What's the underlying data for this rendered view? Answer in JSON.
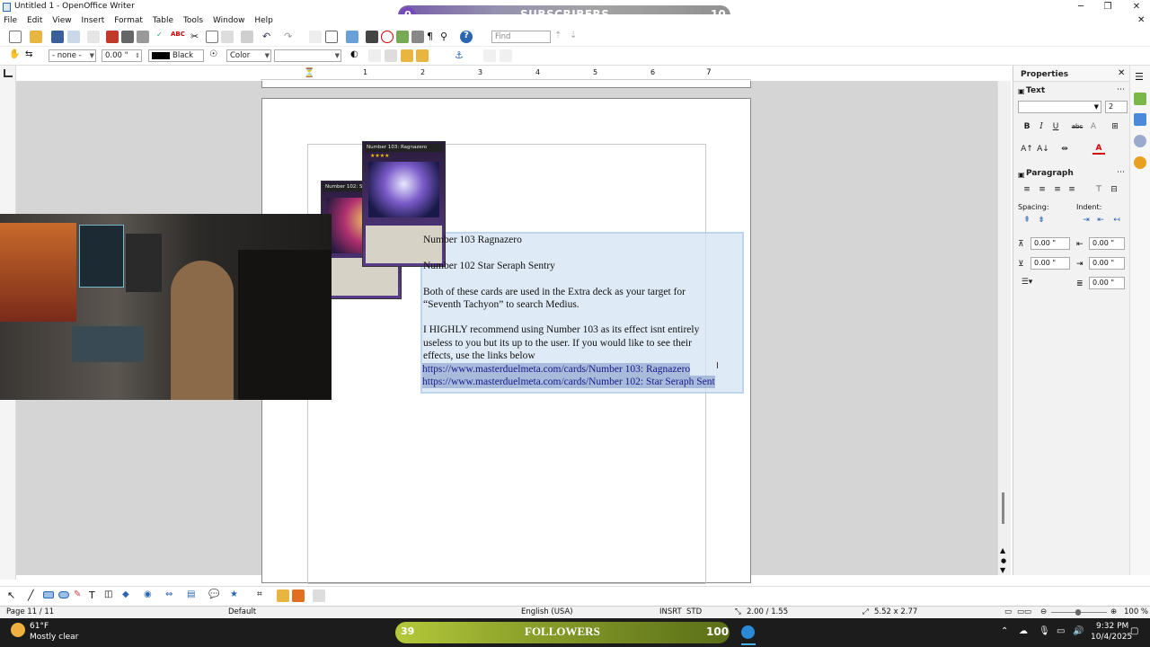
{
  "window": {
    "title": "Untitled 1 - OpenOffice Writer"
  },
  "menu": [
    "File",
    "Edit",
    "View",
    "Insert",
    "Format",
    "Table",
    "Tools",
    "Window",
    "Help"
  ],
  "standard_toolbar": {
    "find_placeholder": "Find"
  },
  "format_toolbar": {
    "paragraph_style": "- none -",
    "line_width": "0.00 \"",
    "line_color": "Black",
    "area_style": "Color",
    "area_value": ""
  },
  "ruler": {
    "marks": [
      "1",
      "2",
      "3",
      "4",
      "5",
      "6",
      "7"
    ]
  },
  "document": {
    "lines": [
      "Number 103 Ragnazero",
      "Number 102 Star Seraph Sentry",
      "Both of these cards are used in the Extra deck as your target for",
      "“Seventh Tachyon” to search Medius.",
      "I HIGHLY recommend using Number 103 as its effect isnt entirely",
      "useless to you but its up to the user. If you would like to see their",
      "effects, use the links below"
    ],
    "links": [
      "https://www.masterduelmeta.com/cards/Number 103: Ragnazero",
      "https://www.masterduelmeta.com/cards/Number 102: Star Seraph Sent"
    ],
    "cards": [
      {
        "name": "Number 103: Ragnazero",
        "stars": "★★★★"
      },
      {
        "name": "Number 102: Star",
        "stars": "★★★★"
      }
    ]
  },
  "sidebar": {
    "title": "Properties",
    "text_section": "Text",
    "font_name": "",
    "font_size": "2",
    "paragraph_section": "Paragraph",
    "spacing_label": "Spacing:",
    "indent_label": "Indent:",
    "above": "0.00 \"",
    "below": "0.00 \"",
    "indent_before": "0.00 \"",
    "indent_after": "0.00 \"",
    "first_line": "0.00 \""
  },
  "status": {
    "page": "Page 11 / 11",
    "style": "Default",
    "language": "English (USA)",
    "insert": "INSRT",
    "selection": "STD",
    "position": "2.00 / 1.55",
    "size": "5.52 x 2.77",
    "zoom": "100 %"
  },
  "overlays": {
    "subscribers": {
      "label": "SUBSCRIBERS",
      "left": "0",
      "right": "10"
    },
    "followers": {
      "label": "FOLLOWERS",
      "left": "39",
      "right": "100"
    }
  },
  "taskbar": {
    "weather_temp": "61°F",
    "weather_desc": "Mostly clear",
    "time": "9:32 PM",
    "date": "10/4/2025"
  },
  "colors": {
    "accent": "#1a1a8a",
    "selection": "#d4e4f4"
  }
}
